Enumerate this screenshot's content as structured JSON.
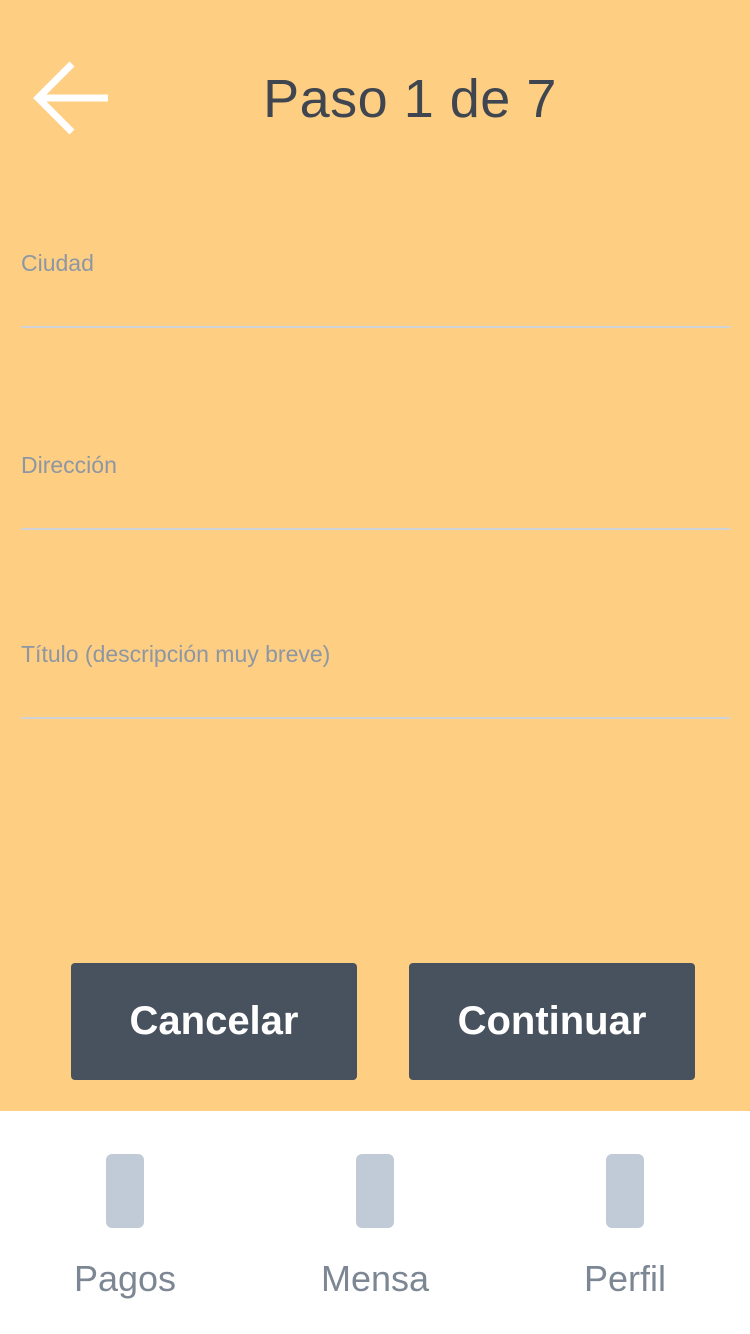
{
  "header": {
    "back_icon": "arrow-left-icon",
    "title": "Paso 1 de 7"
  },
  "form": {
    "fields": [
      {
        "label": "Ciudad",
        "value": ""
      },
      {
        "label": "Dirección",
        "value": ""
      },
      {
        "label": "Título (descripción muy breve)",
        "value": ""
      }
    ]
  },
  "actions": {
    "cancel_label": "Cancelar",
    "continue_label": "Continuar"
  },
  "tabbar": {
    "items": [
      {
        "label": "Pagos",
        "icon": "pagos-icon"
      },
      {
        "label": "Mensa",
        "icon": "mensajes-icon"
      },
      {
        "label": "Perfil",
        "icon": "perfil-icon"
      }
    ]
  },
  "colors": {
    "background": "#FECE83",
    "button": "#48525E",
    "button_text": "#FFFFFF",
    "title_text": "#3F4650",
    "label_text": "#8D97A3",
    "tab_icon": "#C1CBD8",
    "tab_label": "#7D8794",
    "tabbar_bg": "#FFFFFF"
  }
}
